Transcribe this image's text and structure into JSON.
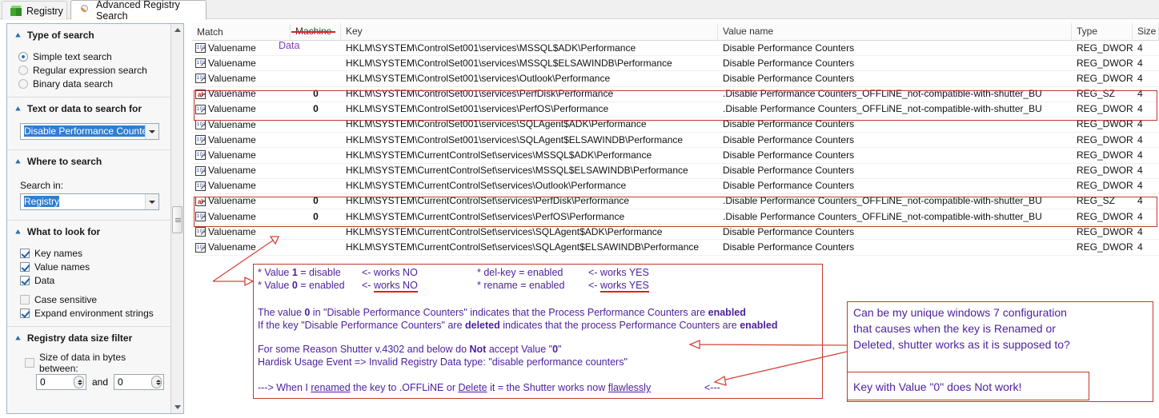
{
  "tabs": [
    {
      "label": "Registry",
      "icon": "registry-cube-icon",
      "active": false
    },
    {
      "label": "Advanced Registry Search",
      "icon": "magnifier-icon",
      "active": true
    }
  ],
  "sidebar": {
    "groups": [
      {
        "title": "Type of search",
        "options": [
          {
            "label": "Simple text search",
            "selected": true
          },
          {
            "label": "Regular expression search",
            "selected": false
          },
          {
            "label": "Binary data search",
            "selected": false
          }
        ]
      },
      {
        "title": "Text or data to search for",
        "combo_value": "Disable Performance Counters"
      },
      {
        "title": "Where to search",
        "field_label": "Search in:",
        "combo_value": "Registry"
      },
      {
        "title": "What to look for",
        "checks": [
          {
            "label": "Key names",
            "checked": true
          },
          {
            "label": "Value names",
            "checked": true
          },
          {
            "label": "Data",
            "checked": true
          },
          {
            "label": "Case sensitive",
            "checked": false
          },
          {
            "label": "Expand environment strings",
            "checked": true
          }
        ]
      },
      {
        "title": "Registry data size filter",
        "filter_label": "Size of data in bytes between:",
        "filter_checked": false,
        "min_value": "0",
        "and_label": "and",
        "max_value": "0"
      }
    ]
  },
  "table": {
    "columns": [
      {
        "key": "match",
        "label": "Match"
      },
      {
        "key": "machine",
        "label": "Machine",
        "struck_through": true,
        "replacement_label": "Data",
        "replacement_color": "#7a3fb0"
      },
      {
        "key": "key",
        "label": "Key"
      },
      {
        "key": "valuename",
        "label": "Value name"
      },
      {
        "key": "type",
        "label": "Type"
      },
      {
        "key": "size",
        "label": "Size"
      }
    ],
    "rows": [
      {
        "match": "Valuename",
        "icon": "reg-dword-icon",
        "data": "",
        "key": "HKLM\\SYSTEM\\ControlSet001\\services\\MSSQL$ADK\\Performance",
        "valuename": "Disable Performance Counters",
        "type": "REG_DWORD",
        "size": "4",
        "highlighted": false
      },
      {
        "match": "Valuename",
        "icon": "reg-dword-icon",
        "data": "",
        "key": "HKLM\\SYSTEM\\ControlSet001\\services\\MSSQL$ELSAWINDB\\Performance",
        "valuename": "Disable Performance Counters",
        "type": "REG_DWORD",
        "size": "4",
        "highlighted": false
      },
      {
        "match": "Valuename",
        "icon": "reg-dword-icon",
        "data": "",
        "key": "HKLM\\SYSTEM\\ControlSet001\\services\\Outlook\\Performance",
        "valuename": "Disable Performance Counters",
        "type": "REG_DWORD",
        "size": "4",
        "highlighted": false
      },
      {
        "match": "Valuename",
        "icon": "reg-sz-icon",
        "data": "0",
        "key": "HKLM\\SYSTEM\\ControlSet001\\services\\PerfDisk\\Performance",
        "valuename": ".Disable Performance Counters_OFFLiNE_not-compatible-with-shutter_BU",
        "type": "REG_SZ",
        "size": "4",
        "highlighted": true
      },
      {
        "match": "Valuename",
        "icon": "reg-dword-icon",
        "data": "0",
        "key": "HKLM\\SYSTEM\\ControlSet001\\services\\PerfOS\\Performance",
        "valuename": ".Disable Performance Counters_OFFLiNE_not-compatible-with-shutter_BU",
        "type": "REG_DWORD",
        "size": "4",
        "highlighted": true
      },
      {
        "match": "Valuename",
        "icon": "reg-dword-icon",
        "data": "",
        "key": "HKLM\\SYSTEM\\ControlSet001\\services\\SQLAgent$ADK\\Performance",
        "valuename": "Disable Performance Counters",
        "type": "REG_DWORD",
        "size": "4",
        "highlighted": false
      },
      {
        "match": "Valuename",
        "icon": "reg-dword-icon",
        "data": "",
        "key": "HKLM\\SYSTEM\\ControlSet001\\services\\SQLAgent$ELSAWINDB\\Performance",
        "valuename": "Disable Performance Counters",
        "type": "REG_DWORD",
        "size": "4",
        "highlighted": false
      },
      {
        "match": "Valuename",
        "icon": "reg-dword-icon",
        "data": "",
        "key": "HKLM\\SYSTEM\\CurrentControlSet\\services\\MSSQL$ADK\\Performance",
        "valuename": "Disable Performance Counters",
        "type": "REG_DWORD",
        "size": "4",
        "highlighted": false
      },
      {
        "match": "Valuename",
        "icon": "reg-dword-icon",
        "data": "",
        "key": "HKLM\\SYSTEM\\CurrentControlSet\\services\\MSSQL$ELSAWINDB\\Performance",
        "valuename": "Disable Performance Counters",
        "type": "REG_DWORD",
        "size": "4",
        "highlighted": false
      },
      {
        "match": "Valuename",
        "icon": "reg-dword-icon",
        "data": "",
        "key": "HKLM\\SYSTEM\\CurrentControlSet\\services\\Outlook\\Performance",
        "valuename": "Disable Performance Counters",
        "type": "REG_DWORD",
        "size": "4",
        "highlighted": false
      },
      {
        "match": "Valuename",
        "icon": "reg-sz-icon",
        "data": "0",
        "key": "HKLM\\SYSTEM\\CurrentControlSet\\services\\PerfDisk\\Performance",
        "valuename": ".Disable Performance Counters_OFFLiNE_not-compatible-with-shutter_BU",
        "type": "REG_SZ",
        "size": "4",
        "highlighted": true
      },
      {
        "match": "Valuename",
        "icon": "reg-dword-icon",
        "data": "0",
        "key": "HKLM\\SYSTEM\\CurrentControlSet\\services\\PerfOS\\Performance",
        "valuename": ".Disable Performance Counters_OFFLiNE_not-compatible-with-shutter_BU",
        "type": "REG_DWORD",
        "size": "4",
        "highlighted": true
      },
      {
        "match": "Valuename",
        "icon": "reg-dword-icon",
        "data": "",
        "key": "HKLM\\SYSTEM\\CurrentControlSet\\services\\SQLAgent$ADK\\Performance",
        "valuename": "Disable Performance Counters",
        "type": "REG_DWORD",
        "size": "4",
        "highlighted": false
      },
      {
        "match": "Valuename",
        "icon": "reg-dword-icon",
        "data": "",
        "key": "HKLM\\SYSTEM\\CurrentControlSet\\services\\SQLAgent$ELSAWINDB\\Performance",
        "valuename": "Disable Performance Counters",
        "type": "REG_DWORD",
        "size": "4",
        "highlighted": false
      }
    ]
  },
  "annotations": {
    "color": "#4b1f9e",
    "box_color": "#c03a2b",
    "notes_box": {
      "line1_a": "* Value 1 = disable",
      "line1_b": "<- works NO",
      "line1_c": "* del-key = enabled",
      "line1_d": "<- works YES",
      "line2_a": "* Value 0 = enabled",
      "line2_b": "<- works NO",
      "line2_c": "* rename = enabled",
      "line2_d": "<- works YES",
      "para1_line1": "The value 0 in \"Disable Performance Counters\" indicates that the Process Performance Counters are enabled",
      "para1_line2": "If the key \"Disable Performance Counters\" are deleted indicates that the process Performance Counters are enabled",
      "para2_line1": "For some Reason Shutter v.4302 and below do Not accept Value \"0\"",
      "para2_line2": "Hardisk Usage Event => Invalid Registry Data type:  \"disable performance counters\"",
      "para3": "--->      When I renamed the key to .OFFLiNE  or Delete it =  the Shutter works now flawlessly",
      "para3_tail": "<---"
    },
    "right_box": {
      "line1": "Can be my unique windows 7 configuration",
      "line2": "that causes when the key is Renamed or",
      "line3": "Deleted, shutter works as it is supposed to?",
      "line4": "Key with Value \"0\"  does Not work!"
    }
  }
}
